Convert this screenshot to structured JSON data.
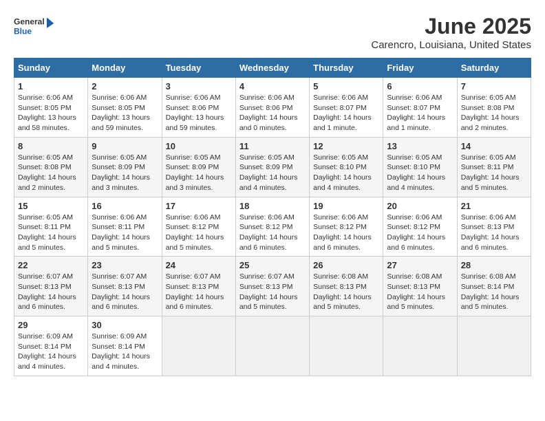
{
  "header": {
    "logo_line1": "General",
    "logo_line2": "Blue",
    "title": "June 2025",
    "subtitle": "Carencro, Louisiana, United States"
  },
  "days_of_week": [
    "Sunday",
    "Monday",
    "Tuesday",
    "Wednesday",
    "Thursday",
    "Friday",
    "Saturday"
  ],
  "weeks": [
    [
      {
        "day": "1",
        "info": "Sunrise: 6:06 AM\nSunset: 8:05 PM\nDaylight: 13 hours\nand 58 minutes."
      },
      {
        "day": "2",
        "info": "Sunrise: 6:06 AM\nSunset: 8:05 PM\nDaylight: 13 hours\nand 59 minutes."
      },
      {
        "day": "3",
        "info": "Sunrise: 6:06 AM\nSunset: 8:06 PM\nDaylight: 13 hours\nand 59 minutes."
      },
      {
        "day": "4",
        "info": "Sunrise: 6:06 AM\nSunset: 8:06 PM\nDaylight: 14 hours\nand 0 minutes."
      },
      {
        "day": "5",
        "info": "Sunrise: 6:06 AM\nSunset: 8:07 PM\nDaylight: 14 hours\nand 1 minute."
      },
      {
        "day": "6",
        "info": "Sunrise: 6:06 AM\nSunset: 8:07 PM\nDaylight: 14 hours\nand 1 minute."
      },
      {
        "day": "7",
        "info": "Sunrise: 6:05 AM\nSunset: 8:08 PM\nDaylight: 14 hours\nand 2 minutes."
      }
    ],
    [
      {
        "day": "8",
        "info": "Sunrise: 6:05 AM\nSunset: 8:08 PM\nDaylight: 14 hours\nand 2 minutes."
      },
      {
        "day": "9",
        "info": "Sunrise: 6:05 AM\nSunset: 8:09 PM\nDaylight: 14 hours\nand 3 minutes."
      },
      {
        "day": "10",
        "info": "Sunrise: 6:05 AM\nSunset: 8:09 PM\nDaylight: 14 hours\nand 3 minutes."
      },
      {
        "day": "11",
        "info": "Sunrise: 6:05 AM\nSunset: 8:09 PM\nDaylight: 14 hours\nand 4 minutes."
      },
      {
        "day": "12",
        "info": "Sunrise: 6:05 AM\nSunset: 8:10 PM\nDaylight: 14 hours\nand 4 minutes."
      },
      {
        "day": "13",
        "info": "Sunrise: 6:05 AM\nSunset: 8:10 PM\nDaylight: 14 hours\nand 4 minutes."
      },
      {
        "day": "14",
        "info": "Sunrise: 6:05 AM\nSunset: 8:11 PM\nDaylight: 14 hours\nand 5 minutes."
      }
    ],
    [
      {
        "day": "15",
        "info": "Sunrise: 6:05 AM\nSunset: 8:11 PM\nDaylight: 14 hours\nand 5 minutes."
      },
      {
        "day": "16",
        "info": "Sunrise: 6:06 AM\nSunset: 8:11 PM\nDaylight: 14 hours\nand 5 minutes."
      },
      {
        "day": "17",
        "info": "Sunrise: 6:06 AM\nSunset: 8:12 PM\nDaylight: 14 hours\nand 5 minutes."
      },
      {
        "day": "18",
        "info": "Sunrise: 6:06 AM\nSunset: 8:12 PM\nDaylight: 14 hours\nand 6 minutes."
      },
      {
        "day": "19",
        "info": "Sunrise: 6:06 AM\nSunset: 8:12 PM\nDaylight: 14 hours\nand 6 minutes."
      },
      {
        "day": "20",
        "info": "Sunrise: 6:06 AM\nSunset: 8:12 PM\nDaylight: 14 hours\nand 6 minutes."
      },
      {
        "day": "21",
        "info": "Sunrise: 6:06 AM\nSunset: 8:13 PM\nDaylight: 14 hours\nand 6 minutes."
      }
    ],
    [
      {
        "day": "22",
        "info": "Sunrise: 6:07 AM\nSunset: 8:13 PM\nDaylight: 14 hours\nand 6 minutes."
      },
      {
        "day": "23",
        "info": "Sunrise: 6:07 AM\nSunset: 8:13 PM\nDaylight: 14 hours\nand 6 minutes."
      },
      {
        "day": "24",
        "info": "Sunrise: 6:07 AM\nSunset: 8:13 PM\nDaylight: 14 hours\nand 6 minutes."
      },
      {
        "day": "25",
        "info": "Sunrise: 6:07 AM\nSunset: 8:13 PM\nDaylight: 14 hours\nand 5 minutes."
      },
      {
        "day": "26",
        "info": "Sunrise: 6:08 AM\nSunset: 8:13 PM\nDaylight: 14 hours\nand 5 minutes."
      },
      {
        "day": "27",
        "info": "Sunrise: 6:08 AM\nSunset: 8:13 PM\nDaylight: 14 hours\nand 5 minutes."
      },
      {
        "day": "28",
        "info": "Sunrise: 6:08 AM\nSunset: 8:14 PM\nDaylight: 14 hours\nand 5 minutes."
      }
    ],
    [
      {
        "day": "29",
        "info": "Sunrise: 6:09 AM\nSunset: 8:14 PM\nDaylight: 14 hours\nand 4 minutes."
      },
      {
        "day": "30",
        "info": "Sunrise: 6:09 AM\nSunset: 8:14 PM\nDaylight: 14 hours\nand 4 minutes."
      },
      {
        "day": "",
        "info": ""
      },
      {
        "day": "",
        "info": ""
      },
      {
        "day": "",
        "info": ""
      },
      {
        "day": "",
        "info": ""
      },
      {
        "day": "",
        "info": ""
      }
    ]
  ]
}
